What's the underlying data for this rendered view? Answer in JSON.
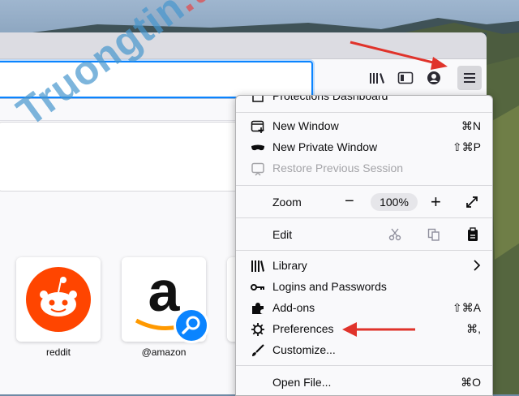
{
  "menu": {
    "protections_dashboard": "Protections Dashboard",
    "new_window": {
      "label": "New Window",
      "shortcut": "⌘N"
    },
    "new_private_window": {
      "label": "New Private Window",
      "shortcut": "⇧⌘P"
    },
    "restore_previous_session": {
      "label": "Restore Previous Session"
    },
    "zoom": {
      "label": "Zoom",
      "minus": "−",
      "value": "100%",
      "plus": "+"
    },
    "edit": {
      "label": "Edit"
    },
    "library": {
      "label": "Library"
    },
    "logins_and_passwords": {
      "label": "Logins and Passwords"
    },
    "addons": {
      "label": "Add-ons",
      "shortcut": "⇧⌘A"
    },
    "preferences": {
      "label": "Preferences",
      "shortcut": "⌘,"
    },
    "customize": {
      "label": "Customize..."
    },
    "open_file": {
      "label": "Open File...",
      "shortcut": "⌘O"
    }
  },
  "top_sites": [
    {
      "label": "reddit"
    },
    {
      "label": "@amazon"
    }
  ],
  "watermark": {
    "main": "Truongtin",
    "suffix": ".top"
  },
  "colors": {
    "accent": "#0a84ff",
    "arrow": "#e0332b",
    "reddit": "#ff4500",
    "search_badge": "#0a84ff"
  }
}
